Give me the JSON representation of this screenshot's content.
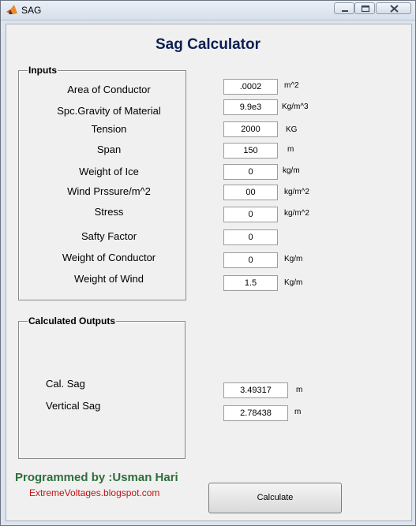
{
  "window": {
    "title": "SAG"
  },
  "app_title": "Sag Calculator",
  "inputs": {
    "panel_title": "Inputs",
    "fields": [
      {
        "label": "Area of Conductor",
        "value": ".0002",
        "unit": "m^2"
      },
      {
        "label": "Spc.Gravity of Material",
        "value": "9.9e3",
        "unit": "Kg/m^3"
      },
      {
        "label": "Tension",
        "value": "2000",
        "unit": "KG"
      },
      {
        "label": "Span",
        "value": "150",
        "unit": "m"
      },
      {
        "label": "Weight of Ice",
        "value": "0",
        "unit": "kg/m"
      },
      {
        "label": "Wind Prssure/m^2",
        "value": "00",
        "unit": "kg/m^2"
      },
      {
        "label": "Stress",
        "value": "0",
        "unit": "kg/m^2"
      },
      {
        "label": "Safty Factor",
        "value": "0",
        "unit": ""
      },
      {
        "label": "Weight of Conductor",
        "value": "0",
        "unit": "Kg/m"
      },
      {
        "label": "Weight of Wind",
        "value": "1.5",
        "unit": "Kg/m"
      }
    ]
  },
  "outputs": {
    "panel_title": "Calculated Outputs",
    "fields": [
      {
        "label": "Cal. Sag",
        "value": "3.49317",
        "unit": "m"
      },
      {
        "label": "Vertical Sag",
        "value": "2.78438",
        "unit": "m"
      }
    ]
  },
  "credit": "Programmed by :Usman Hari",
  "blog": "ExtremeVoltages.blogspot.com",
  "calculate_label": "Calculate"
}
